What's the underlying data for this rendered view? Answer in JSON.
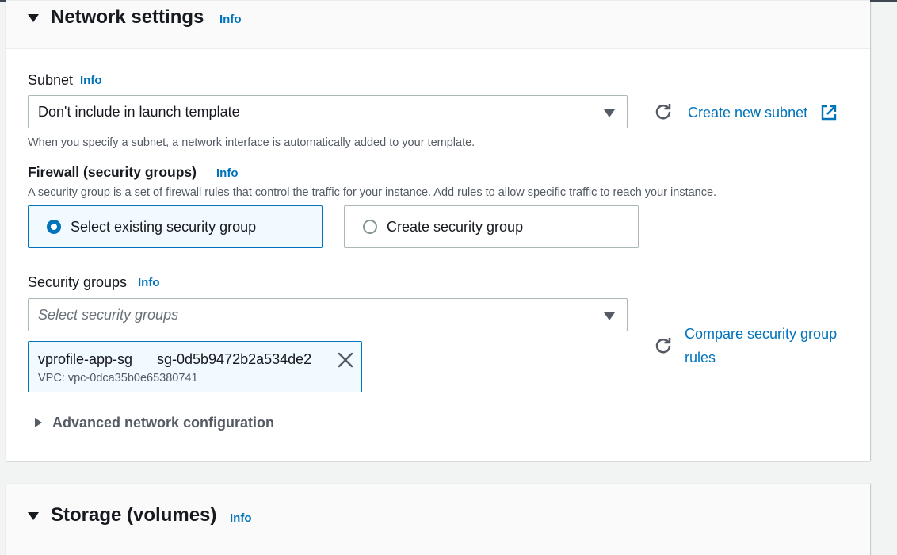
{
  "network": {
    "title": "Network settings",
    "info": "Info",
    "subnet": {
      "label": "Subnet",
      "info": "Info",
      "value": "Don't include in launch template",
      "create_link": "Create new subnet",
      "description": "When you specify a subnet, a network interface is automatically added to your template."
    },
    "firewall": {
      "label": "Firewall (security groups)",
      "info": "Info",
      "description": "A security group is a set of firewall rules that control the traffic for your instance. Add rules to allow specific traffic to reach your instance.",
      "options": [
        {
          "label": "Select existing security group",
          "selected": true
        },
        {
          "label": "Create security group",
          "selected": false
        }
      ]
    },
    "security_groups": {
      "label": "Security groups",
      "info": "Info",
      "placeholder": "Select security groups",
      "compare_link_line1": "Compare security group",
      "compare_link_line2": "rules",
      "selected": [
        {
          "name": "vprofile-app-sg",
          "id": "sg-0d5b9472b2a534de2",
          "vpc": "VPC: vpc-0dca35b0e65380741"
        }
      ]
    },
    "advanced": "Advanced network configuration"
  },
  "storage": {
    "title": "Storage (volumes)",
    "info": "Info"
  },
  "colors": {
    "link": "#0073bb",
    "text": "#16191f",
    "muted": "#545b64",
    "selected_bg": "#f1faff",
    "border": "#aab7b8"
  }
}
